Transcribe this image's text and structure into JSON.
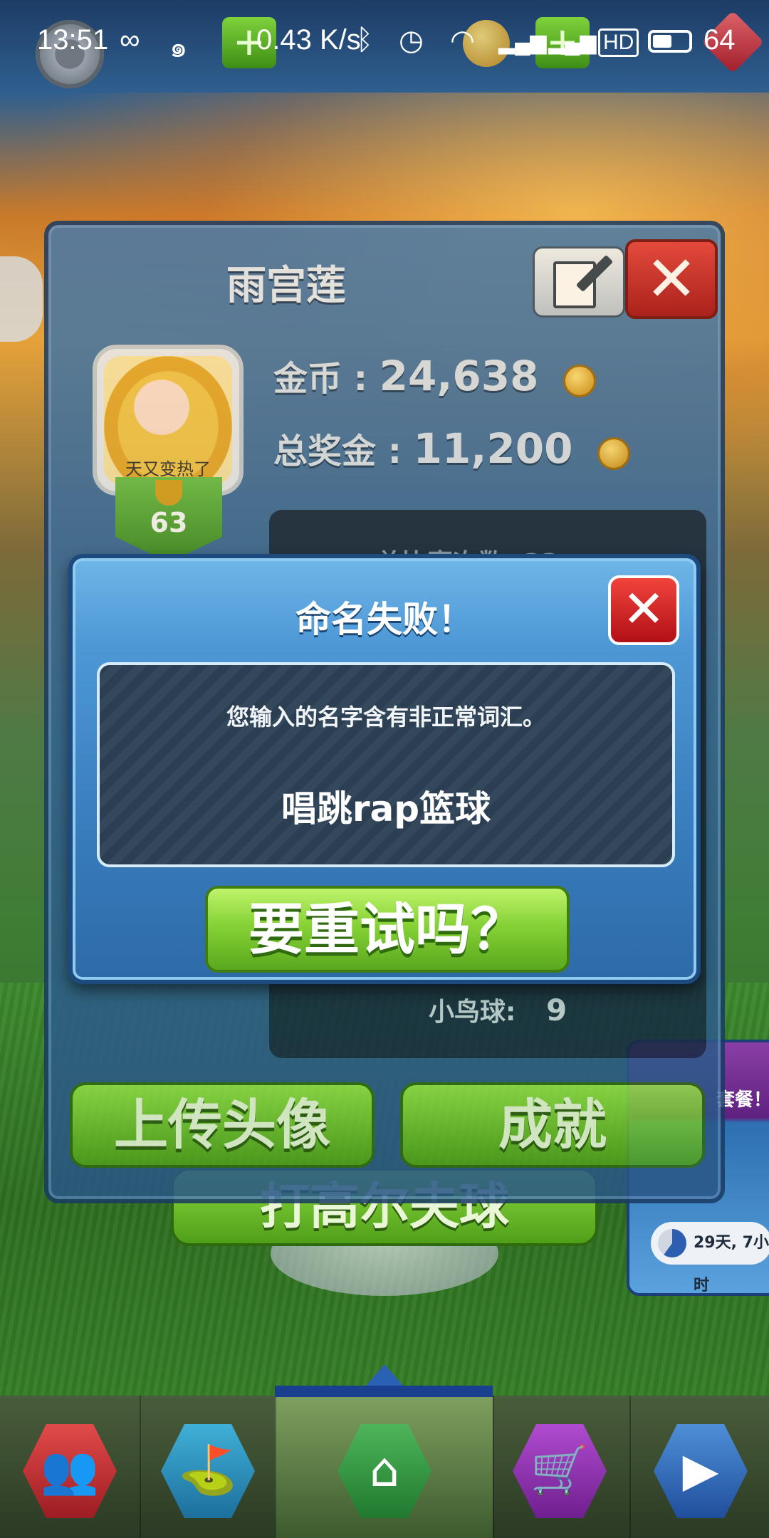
{
  "status_bar": {
    "time": "13:51",
    "net_speed": "0.43 K/s",
    "battery": "64"
  },
  "profile": {
    "name": "雨宫莲",
    "avatar_caption": "天又变热了",
    "rank": "63",
    "coins_label": "金币 :",
    "coins_value": "24,638",
    "prize_label": "总奖金 :",
    "prize_value": "11,200",
    "stat_partial_label": "总比赛次数: 23",
    "birdies_label": "小鸟球:",
    "birdies_value": "9",
    "upload_avatar_label": "上传头像",
    "achievements_label": "成就"
  },
  "background": {
    "play_button_label": "打高尔夫球",
    "promo_text": "套餐！",
    "promo_timer": "29天, 7小时"
  },
  "dialog": {
    "title": "命名失败！",
    "message": "您输入的名字含有非正常词汇。",
    "entered_name": "唱跳rap篮球",
    "retry_label": "要重试吗？"
  },
  "bottom_nav": {
    "items": [
      {
        "icon": "friends-icon"
      },
      {
        "icon": "golf-bag-icon"
      },
      {
        "icon": "home-icon"
      },
      {
        "icon": "shop-cart-icon"
      },
      {
        "icon": "video-icon"
      }
    ],
    "active": "home-icon"
  },
  "colors": {
    "dialog_blue": "#4e98d6",
    "retry_green": "#86d236",
    "close_red": "#d22a2a"
  }
}
